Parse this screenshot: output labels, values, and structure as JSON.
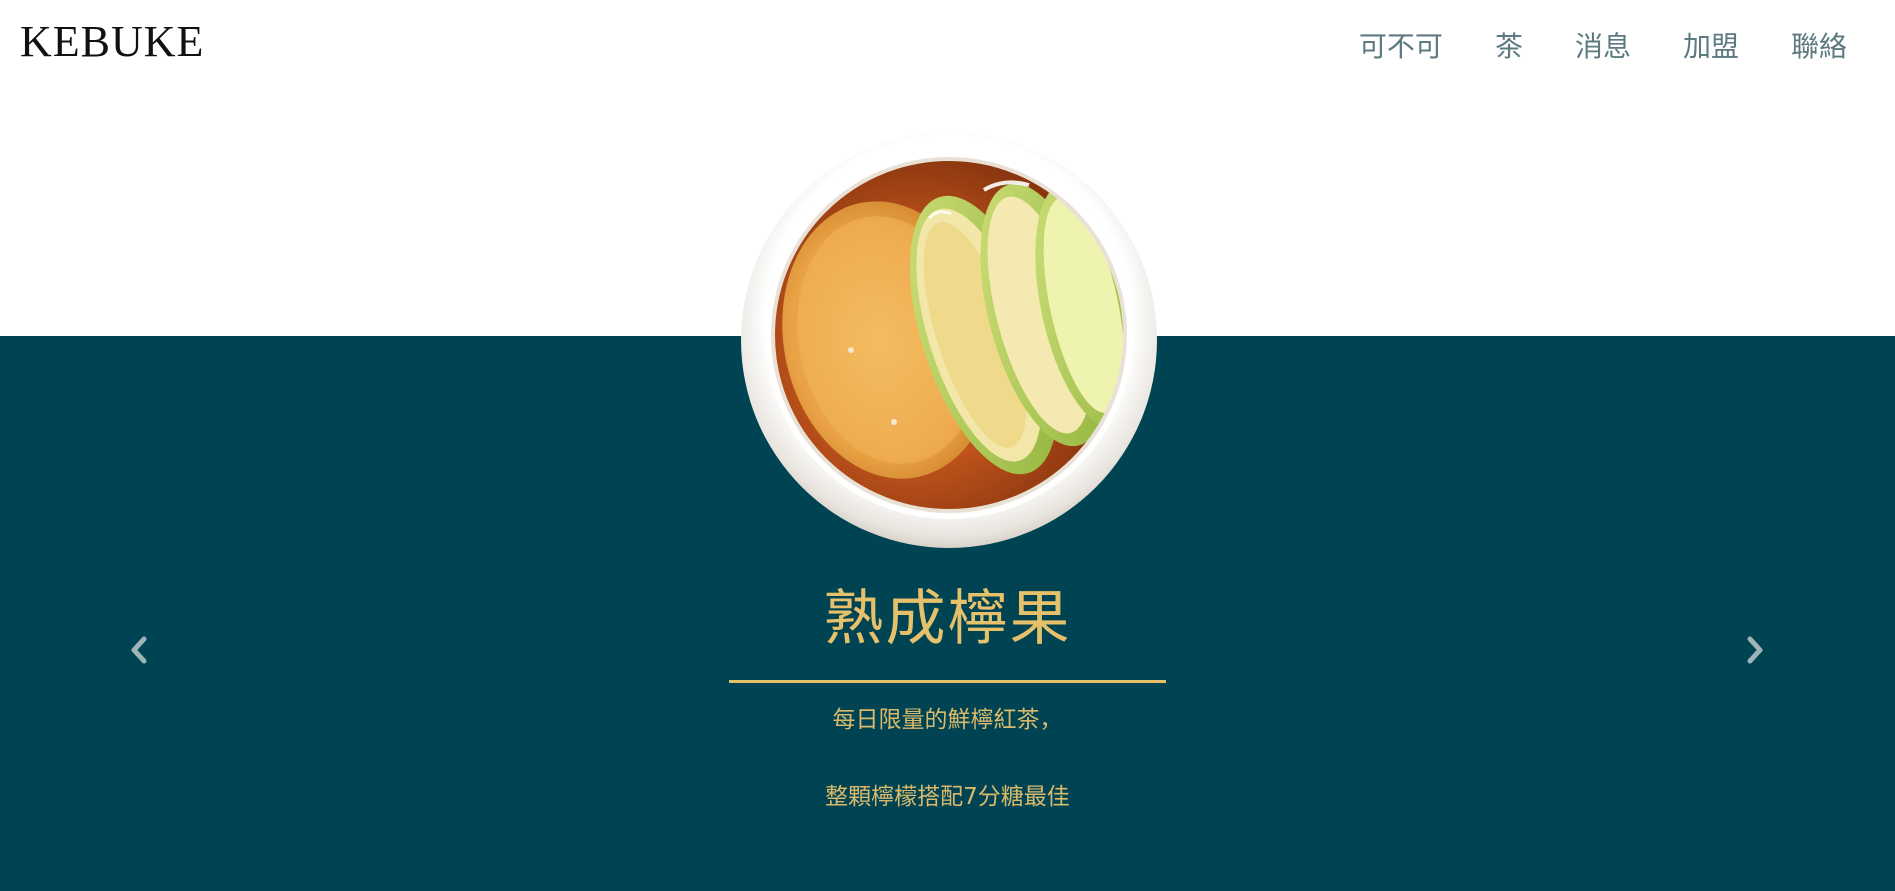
{
  "header": {
    "logo": "KEBUKE",
    "nav": [
      {
        "label": "可不可"
      },
      {
        "label": "茶"
      },
      {
        "label": "消息"
      },
      {
        "label": "加盟"
      },
      {
        "label": "聯絡"
      }
    ]
  },
  "slide": {
    "image_icon": "lemon-tea-cup-image",
    "title": "熟成檸果",
    "desc_line1": "每日限量的鮮檸紅茶，",
    "desc_line2": "整顆檸檬搭配7分糖最佳"
  },
  "carousel": {
    "prev_icon": "chevron-left-icon",
    "next_icon": "chevron-right-icon"
  },
  "colors": {
    "band": "#004454",
    "accent_gold": "#e6c06a",
    "nav_text": "#5c7a80",
    "logo_text": "#111111"
  }
}
